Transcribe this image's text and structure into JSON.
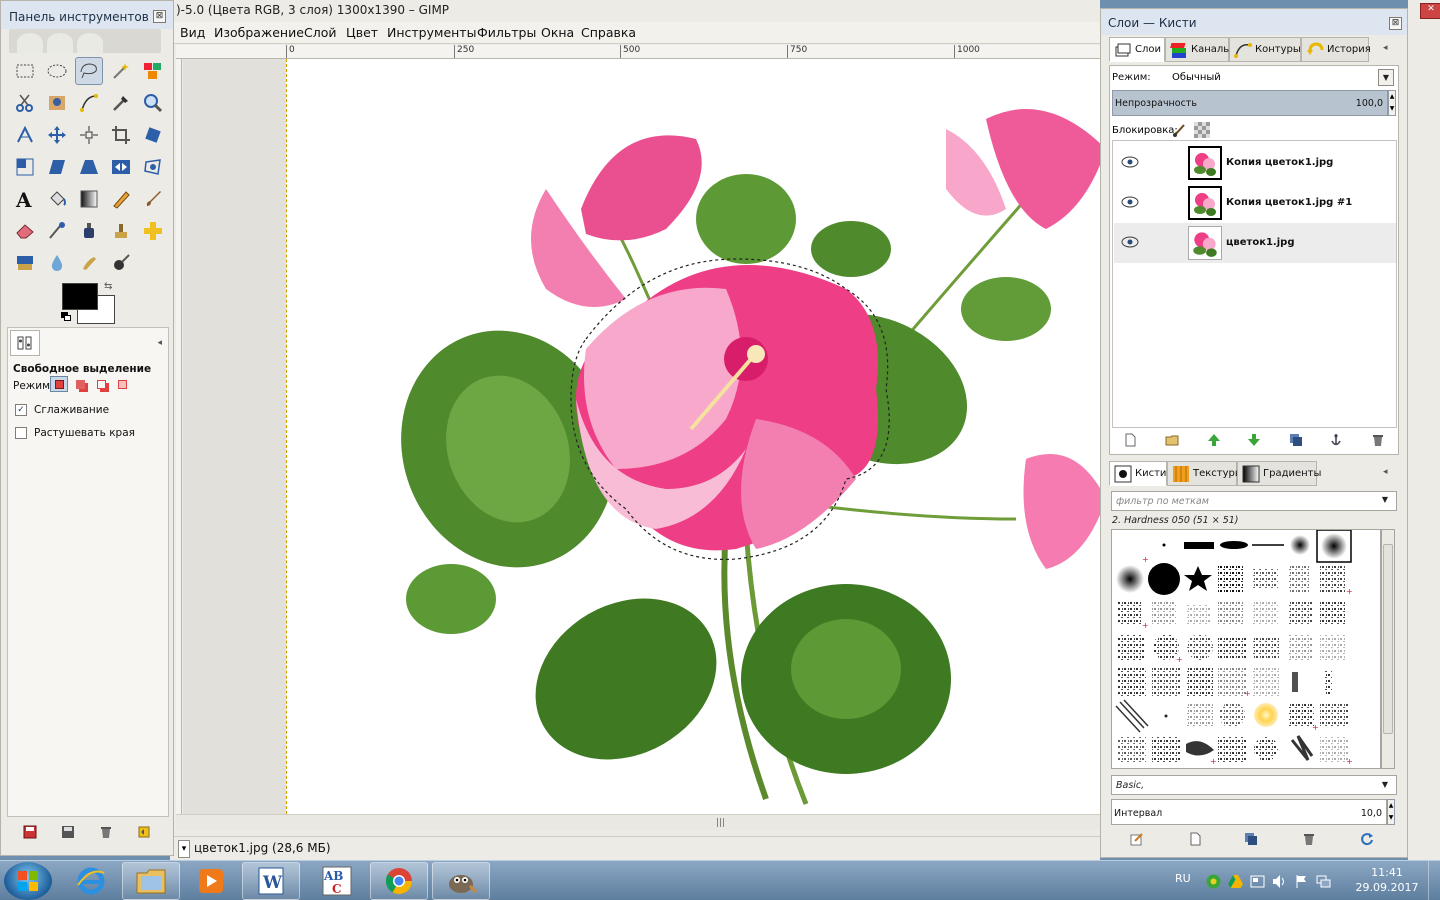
{
  "gimp": {
    "title": ")-5.0 (Цвета RGB, 3 слоя) 1300x1390 – GIMP",
    "menu": [
      "Вид",
      "Изображение",
      "Слой",
      "Цвет",
      "Инструменты",
      "Фильтры",
      "Окна",
      "Справка"
    ],
    "ruler": [
      "0",
      "250",
      "500",
      "750",
      "1000"
    ],
    "status_text": "цветок1.jpg (28,6 МБ)",
    "scroll_grip": "|||"
  },
  "toolbox": {
    "title": "Панель инструментов ...",
    "close": "⊠",
    "options_title": "Свободное выделение",
    "mode_label": "Режим:",
    "antialias_label": "Сглаживание",
    "antialias_checked": "✓",
    "feather_label": "Растушевать края",
    "collapse": "◂"
  },
  "dock": {
    "title": "Слои — Кисти",
    "close": "⊠",
    "tabs_top": [
      "Слои",
      "Каналы",
      "Контуры",
      "История"
    ],
    "mode_label": "Режим:",
    "mode_value": "Обычный",
    "opacity_label": "Непрозрачность",
    "opacity_value": "100,0",
    "lock_label": "Блокировка:",
    "layers": [
      {
        "name": "Копия цветок1.jpg"
      },
      {
        "name": "Копия цветок1.jpg #1"
      },
      {
        "name": "цветок1.jpg"
      }
    ],
    "tabs_bottom": [
      "Кисти",
      "Текстуры",
      "Градиенты"
    ],
    "filter_placeholder": "фильтр по меткам",
    "brush_name": "2. Hardness 050 (51 × 51)",
    "brush_tag": "Basic,",
    "spacing_label": "Интервал",
    "spacing_value": "10,0",
    "arrow": "▼",
    "collapse": "◂"
  },
  "taskbar": {
    "lang": "RU",
    "time": "11:41",
    "date": "29.09.2017",
    "abc": "ABC"
  },
  "colors": {
    "fg": "#000000",
    "bg": "#ffffff",
    "selection_guide": "#c8a000"
  }
}
